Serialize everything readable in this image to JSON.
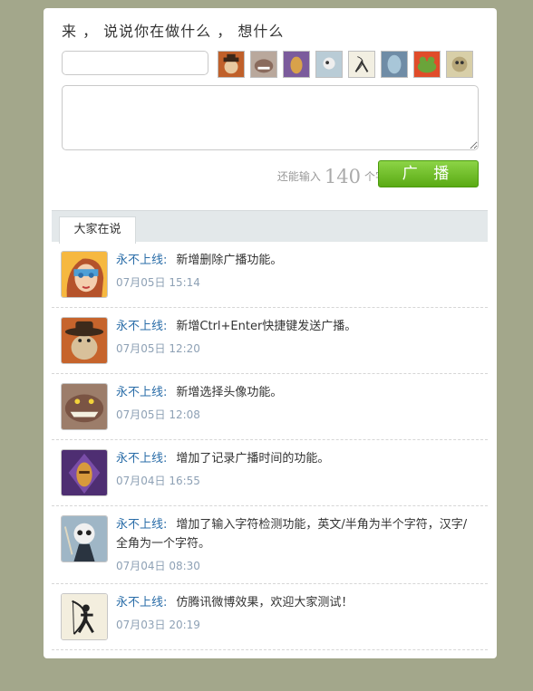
{
  "composer": {
    "prompt": "来 ， 说说你在做什么 ， 想什么",
    "name_value": "",
    "message_value": "",
    "counter_prefix": "还能输入",
    "counter_value": "140",
    "counter_suffix": "个字",
    "post_label": "广 播",
    "avatars": [
      "pirate-avatar",
      "wolf-avatar",
      "knight-avatar",
      "skull-avatar",
      "archer-avatar",
      "ghost-avatar",
      "frog-avatar",
      "monster-avatar"
    ]
  },
  "feed": {
    "tab_label": "大家在说",
    "items": [
      {
        "author": "永不上线:",
        "text": "新增删除广播功能。",
        "time": "07月05日 15:14",
        "avatar": "girl-avatar"
      },
      {
        "author": "永不上线:",
        "text": "新增Ctrl+Enter快捷键发送广播。",
        "time": "07月05日 12:20",
        "avatar": "pirate-avatar"
      },
      {
        "author": "永不上线:",
        "text": "新增选择头像功能。",
        "time": "07月05日 12:08",
        "avatar": "wolf-avatar"
      },
      {
        "author": "永不上线:",
        "text": "增加了记录广播时间的功能。",
        "time": "07月04日 16:55",
        "avatar": "knight-avatar"
      },
      {
        "author": "永不上线:",
        "text": "增加了输入字符检测功能，英文/半角为半个字符，汉字/全角为一个字符。",
        "time": "07月04日 08:30",
        "avatar": "skull-avatar"
      },
      {
        "author": "永不上线:",
        "text": "仿腾讯微博效果，欢迎大家测试！",
        "time": "07月03日 20:19",
        "avatar": "archer-avatar"
      }
    ]
  }
}
